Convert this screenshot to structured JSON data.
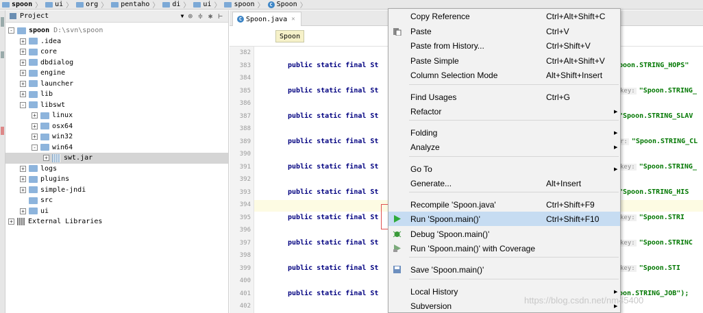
{
  "breadcrumbs": [
    "spoon",
    "ui",
    "org",
    "pentaho",
    "di",
    "ui",
    "spoon",
    "Spoon"
  ],
  "project_panel": {
    "title": "Project",
    "tree": [
      {
        "label": "spoon",
        "path": "D:\\svn\\spoon",
        "expanded": true,
        "bold": true,
        "depth": 0,
        "icon": "module"
      },
      {
        "label": ".idea",
        "depth": 1,
        "icon": "folder",
        "expander": "+"
      },
      {
        "label": "core",
        "depth": 1,
        "icon": "folder",
        "expander": "+"
      },
      {
        "label": "dbdialog",
        "depth": 1,
        "icon": "folder",
        "expander": "+"
      },
      {
        "label": "engine",
        "depth": 1,
        "icon": "folder",
        "expander": "+"
      },
      {
        "label": "launcher",
        "depth": 1,
        "icon": "folder",
        "expander": "+"
      },
      {
        "label": "lib",
        "depth": 1,
        "icon": "folder",
        "expander": "+"
      },
      {
        "label": "libswt",
        "depth": 1,
        "icon": "folder",
        "expander": "-"
      },
      {
        "label": "linux",
        "depth": 2,
        "icon": "folder",
        "expander": "+"
      },
      {
        "label": "osx64",
        "depth": 2,
        "icon": "folder",
        "expander": "+"
      },
      {
        "label": "win32",
        "depth": 2,
        "icon": "folder",
        "expander": "+"
      },
      {
        "label": "win64",
        "depth": 2,
        "icon": "folder",
        "expander": "-"
      },
      {
        "label": "swt.jar",
        "depth": 3,
        "icon": "jar",
        "expander": "+",
        "selected": true
      },
      {
        "label": "logs",
        "depth": 1,
        "icon": "folder",
        "expander": "+"
      },
      {
        "label": "plugins",
        "depth": 1,
        "icon": "folder",
        "expander": "+"
      },
      {
        "label": "simple-jndi",
        "depth": 1,
        "icon": "folder",
        "expander": "+"
      },
      {
        "label": "src",
        "depth": 1,
        "icon": "folder",
        "expander": ""
      },
      {
        "label": "ui",
        "depth": 1,
        "icon": "folder",
        "expander": "+"
      },
      {
        "label": "External Libraries",
        "depth": 0,
        "icon": "library",
        "expander": "+"
      }
    ]
  },
  "editor": {
    "tab": "Spoon.java",
    "crumb": "Spoon",
    "line_numbers": [
      "382",
      "383",
      "384",
      "385",
      "386",
      "387",
      "388",
      "389",
      "390",
      "391",
      "392",
      "393",
      "394",
      "395",
      "396",
      "397",
      "398",
      "399",
      "400",
      "401",
      "402"
    ],
    "code_prefix": "public static final St",
    "line_tails": [
      {
        "line": "383",
        "key": "",
        "text": "poon.STRING_HOPS\""
      },
      {
        "line": "385",
        "key": "key:",
        "text": "\"Spoon.STRING_"
      },
      {
        "line": "387",
        "key": "",
        "text": "\"Spoon.STRING_SLAV"
      },
      {
        "line": "389",
        "key": "r:",
        "text": "\"Spoon.STRING_CL"
      },
      {
        "line": "391",
        "key": "key:",
        "text": "\"Spoon.STRING_"
      },
      {
        "line": "393",
        "key": "",
        "text": "\"Spoon.STRING_HIS"
      },
      {
        "line": "395",
        "key": "key:",
        "text": "\"Spoon.STRI"
      },
      {
        "line": "397",
        "key": "key:",
        "text": "\"Spoon.STRINC"
      },
      {
        "line": "399",
        "key": "key:",
        "text": "\"Spoon.STI"
      },
      {
        "line": "401",
        "key": "",
        "text": "oon.STRING_JOB\");"
      }
    ]
  },
  "context_menu": {
    "items": [
      {
        "label": "Copy Reference",
        "shortcut": "Ctrl+Alt+Shift+C"
      },
      {
        "label": "Paste",
        "shortcut": "Ctrl+V",
        "icon": "paste-icon"
      },
      {
        "label": "Paste from History...",
        "shortcut": "Ctrl+Shift+V"
      },
      {
        "label": "Paste Simple",
        "shortcut": "Ctrl+Alt+Shift+V"
      },
      {
        "label": "Column Selection Mode",
        "shortcut": "Alt+Shift+Insert"
      },
      {
        "label": "Find Usages",
        "shortcut": "Ctrl+G"
      },
      {
        "label": "Refactor",
        "shortcut": "",
        "submenu": true
      },
      {
        "label": "Folding",
        "shortcut": "",
        "submenu": true
      },
      {
        "label": "Analyze",
        "shortcut": "",
        "submenu": true
      },
      {
        "label": "Go To",
        "shortcut": "",
        "submenu": true
      },
      {
        "label": "Generate...",
        "shortcut": "Alt+Insert"
      },
      {
        "label": "Recompile 'Spoon.java'",
        "shortcut": "Ctrl+Shift+F9"
      },
      {
        "label": "Run 'Spoon.main()'",
        "shortcut": "Ctrl+Shift+F10",
        "icon": "run-icon",
        "selected": true
      },
      {
        "label": "Debug 'Spoon.main()'",
        "shortcut": "",
        "icon": "debug-icon"
      },
      {
        "label": "Run 'Spoon.main()' with Coverage",
        "shortcut": "",
        "icon": "coverage-icon"
      },
      {
        "label": "Save 'Spoon.main()'",
        "shortcut": "",
        "icon": "save-icon"
      },
      {
        "label": "Local History",
        "shortcut": "",
        "submenu": true
      },
      {
        "label": "Subversion",
        "shortcut": "",
        "submenu": true
      }
    ]
  },
  "watermark": "https://blog.csdn.net/nm45400",
  "colors": {
    "keyword": "#000080",
    "string": "#007700",
    "menu_highlight": "#c6dcf2",
    "annotation_box": "#e05050",
    "run_green": "#2eaa3a"
  }
}
